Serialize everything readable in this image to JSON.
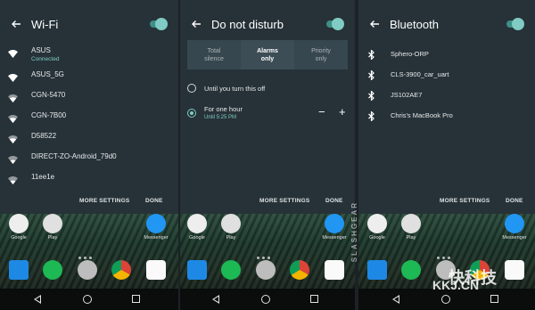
{
  "wifi_panel": {
    "title": "Wi-Fi",
    "networks": [
      {
        "name": "ASUS",
        "status": "Connected"
      },
      {
        "name": "ASUS_5G",
        "status": ""
      },
      {
        "name": "CGN-5470",
        "status": ""
      },
      {
        "name": "CGN-7B00",
        "status": ""
      },
      {
        "name": "D58522",
        "status": ""
      },
      {
        "name": "DIRECT-ZO-Android_79d0",
        "status": ""
      },
      {
        "name": "11ee1e",
        "status": ""
      }
    ],
    "more_settings": "MORE SETTINGS",
    "done": "DONE"
  },
  "dnd_panel": {
    "title": "Do not disturb",
    "modes": [
      {
        "label": "Total\nsilence",
        "active": false
      },
      {
        "label": "Alarms\nonly",
        "active": true
      },
      {
        "label": "Priority\nonly",
        "active": false
      }
    ],
    "option_until_off": "Until you turn this off",
    "option_one_hour": "For one hour",
    "option_one_hour_sub": "Until 5:25 PM",
    "minus": "−",
    "plus": "+",
    "more_settings": "MORE SETTINGS",
    "done": "DONE"
  },
  "bt_panel": {
    "title": "Bluetooth",
    "devices": [
      "Sphero-ORP",
      "CLS-3900_car_uart",
      "JS102AE7",
      "Chris's MacBook Pro"
    ],
    "more_settings": "MORE SETTINGS",
    "done": "DONE"
  },
  "home": {
    "labels": {
      "google": "Google",
      "play": "Play",
      "messenger": "Messenger"
    }
  },
  "watermarks": {
    "side": "SLASHGEAR",
    "site_cn": "快科技",
    "site": "KKJ.CN"
  },
  "colors": {
    "accent": "#80cbc4",
    "panel_bg": "#263238",
    "segment_bg": "#37474f"
  },
  "icons": [
    "back-arrow-icon",
    "wifi-signal-icon",
    "bluetooth-icon",
    "toggle-switch"
  ]
}
